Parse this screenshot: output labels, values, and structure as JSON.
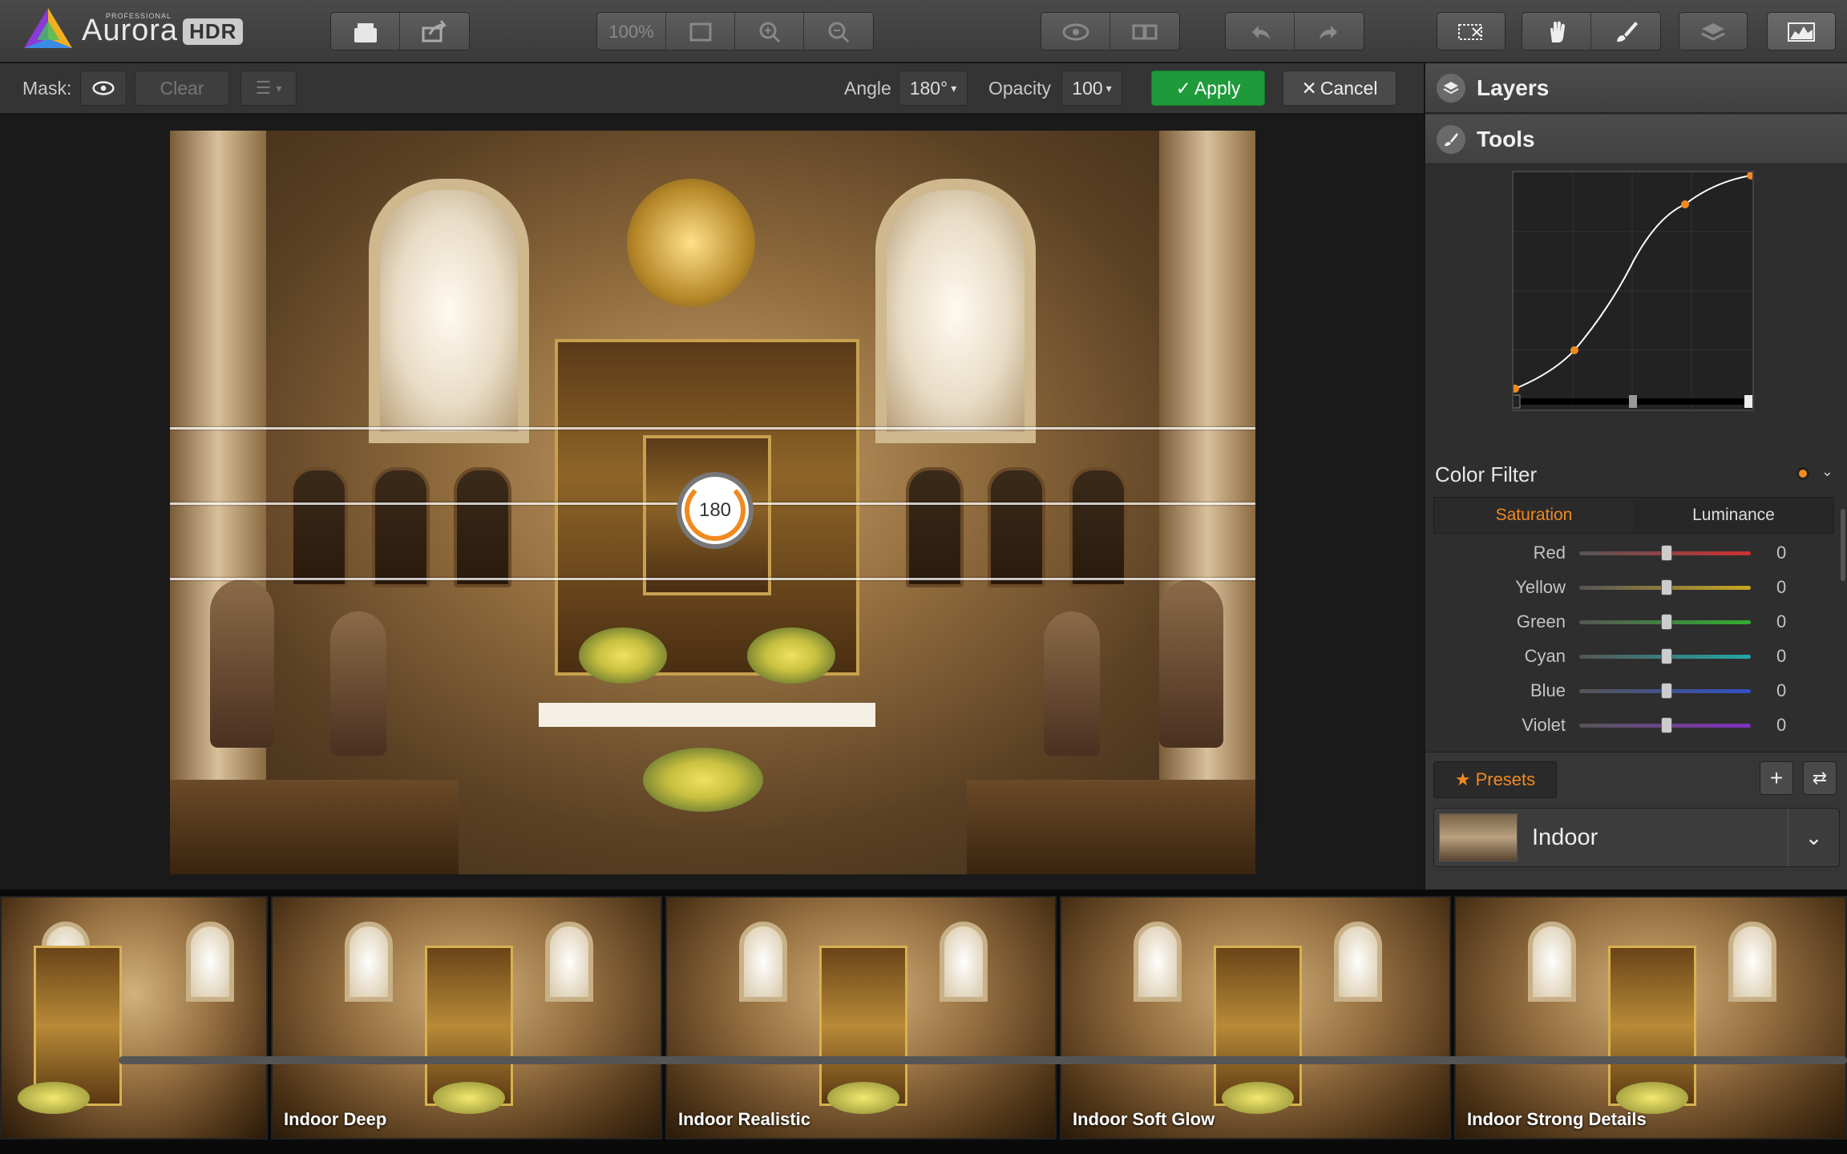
{
  "app": {
    "logo_pro": "PROFESSIONAL",
    "logo_name": "Aurora",
    "logo_hdr": "HDR"
  },
  "toolbar": {
    "zoom_label": "100%"
  },
  "options_bar": {
    "mask_label": "Mask:",
    "clear_label": "Clear",
    "angle_label": "Angle",
    "angle_value": "180°",
    "opacity_label": "Opacity",
    "opacity_value": "100",
    "apply_label": "Apply",
    "cancel_label": "Cancel"
  },
  "canvas": {
    "dial_value": "180"
  },
  "panel": {
    "layers_title": "Layers",
    "tools_title": "Tools",
    "color_filter_title": "Color Filter",
    "tabs": [
      "Saturation",
      "Luminance"
    ],
    "active_tab": "Saturation",
    "sliders": [
      {
        "label": "Red",
        "value": "0",
        "color": "#d03030"
      },
      {
        "label": "Yellow",
        "value": "0",
        "color": "#c8a820"
      },
      {
        "label": "Green",
        "value": "0",
        "color": "#30b030"
      },
      {
        "label": "Cyan",
        "value": "0",
        "color": "#20a8a8"
      },
      {
        "label": "Blue",
        "value": "0",
        "color": "#3050c8"
      },
      {
        "label": "Violet",
        "value": "0",
        "color": "#8030c0"
      }
    ],
    "presets_label": "Presets",
    "preset_selected": "Indoor"
  },
  "filmstrip": {
    "items": [
      {
        "label": ""
      },
      {
        "label": "Indoor Deep"
      },
      {
        "label": "Indoor Realistic"
      },
      {
        "label": "Indoor Soft Glow"
      },
      {
        "label": "Indoor Strong Details"
      }
    ]
  },
  "colors": {
    "accent": "#f08a20",
    "apply": "#1f9a3a"
  }
}
